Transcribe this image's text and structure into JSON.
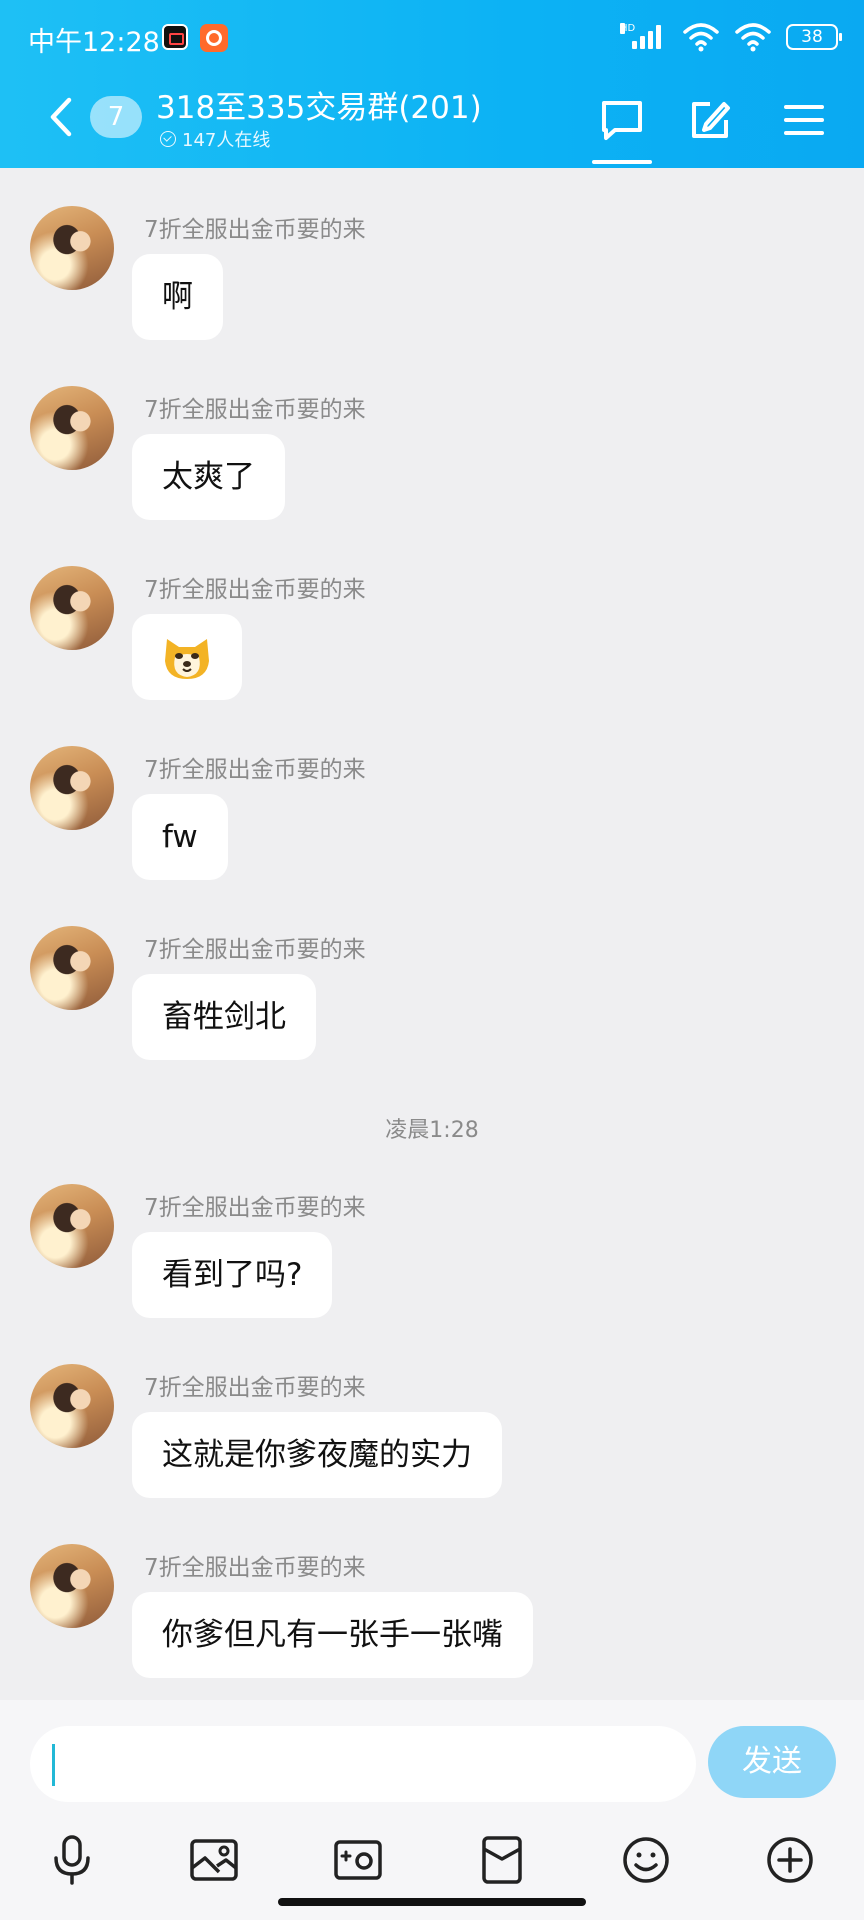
{
  "status_bar": {
    "time": "中午12:28",
    "network_label": "HD",
    "battery": "38",
    "icons": [
      "video-app-icon",
      "app-icon",
      "signal-icon",
      "wifi-icon",
      "wifi-icon",
      "battery-icon"
    ]
  },
  "header": {
    "back_icon": "chevron-left-icon",
    "unread_count": "7",
    "title": "318至335交易群(201)",
    "online_text": "147人在线",
    "icons": [
      "chat-icon",
      "edit-icon",
      "menu-icon"
    ]
  },
  "messages": [
    {
      "sender": "7折全服出金币要的来",
      "text": "啊"
    },
    {
      "sender": "7折全服出金币要的来",
      "text": "太爽了"
    },
    {
      "sender": "7折全服出金币要的来",
      "text": "",
      "sticker": "shiba-dog-sticker"
    },
    {
      "sender": "7折全服出金币要的来",
      "text": "fw"
    },
    {
      "sender": "7折全服出金币要的来",
      "text": "畜牲剑北"
    },
    {
      "sender": "7折全服出金币要的来",
      "text": "看到了吗?"
    },
    {
      "sender": "7折全服出金币要的来",
      "text": "这就是你爹夜魔的实力"
    },
    {
      "sender": "7折全服出金币要的来",
      "text": "你爹但凡有一张手一张嘴"
    }
  ],
  "timestamp": "凌晨1:28",
  "input": {
    "value": "",
    "placeholder": "",
    "send_label": "发送"
  },
  "toolbar": {
    "icons": [
      "microphone-icon",
      "image-icon",
      "camera-icon",
      "red-packet-icon",
      "emoji-icon",
      "plus-icon"
    ]
  },
  "colors": {
    "header_bg": "#0cb2f4",
    "send_button": "#8fd6f7",
    "chat_bg": "#efeff1"
  }
}
